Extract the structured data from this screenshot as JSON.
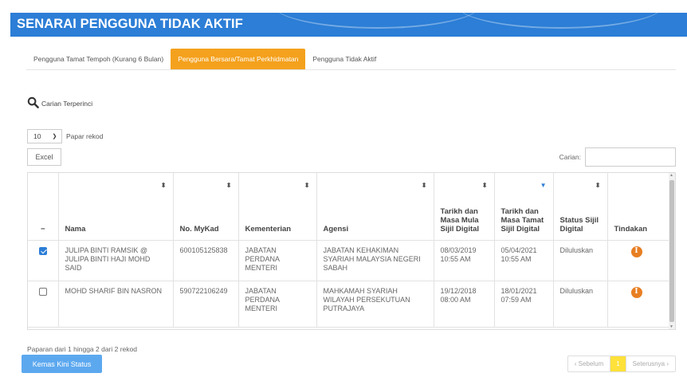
{
  "header": {
    "title": "SENARAI PENGGUNA TIDAK AKTIF",
    "bg_color": "#2c7ed6"
  },
  "tabs": [
    {
      "label": "Pengguna Tamat Tempoh (Kurang 6 Bulan)",
      "active": false
    },
    {
      "label": "Pengguna Bersara/Tamat Perkhidmatan",
      "active": true
    },
    {
      "label": "Pengguna Tidak Aktif",
      "active": false
    }
  ],
  "advanced_search": {
    "label": "Carian Terperinci",
    "icon": "search-icon"
  },
  "page_length": {
    "value": "10",
    "label": "Papar rekod"
  },
  "excel_button": "Excel",
  "search": {
    "label": "Carian:",
    "value": ""
  },
  "table": {
    "columns": {
      "select": "−",
      "nama": "Nama",
      "mykad": "No. MyKad",
      "kementerian": "Kementerian",
      "agensi": "Agensi",
      "mula": "Tarikh dan Masa Mula Sijil Digital",
      "tamat": "Tarikh dan Masa Tamat Sijil Digital",
      "status": "Status Sijil Digital",
      "tindakan": "Tindakan"
    },
    "rows": [
      {
        "checked": true,
        "nama": "JULIPA BINTI RAMSIK @ JULIPA BINTI HAJI MOHD SAID",
        "mykad": "600105125838",
        "kementerian": "JABATAN PERDANA MENTERI",
        "agensi": "JABATAN KEHAKIMAN SYARIAH MALAYSIA NEGERI SABAH",
        "mula": "08/03/2019 10:55 AM",
        "tamat": "05/04/2021 10:55 AM",
        "status": "Diluluskan",
        "action_icon": "info-icon"
      },
      {
        "checked": false,
        "nama": "MOHD SHARIF BIN NASRON",
        "mykad": "590722106249",
        "kementerian": "JABATAN PERDANA MENTERI",
        "agensi": "MAHKAMAH SYARIAH WILAYAH PERSEKUTUAN PUTRAJAYA",
        "mula": "19/12/2018 08:00 AM",
        "tamat": "18/01/2021 07:59 AM",
        "status": "Diluluskan",
        "action_icon": "info-icon"
      }
    ]
  },
  "info_text": "Paparan dari 1 hingga 2 dari 2 rekod",
  "update_button": "Kemas Kini Status",
  "pager": {
    "prev": "‹ Sebelum",
    "current": "1",
    "next": "Seterusnya ›"
  },
  "colors": {
    "accent_tab": "#f4a11d",
    "action_icon": "#e87e22",
    "current_page": "#ffe13a",
    "update_button": "#5ca8ef"
  }
}
